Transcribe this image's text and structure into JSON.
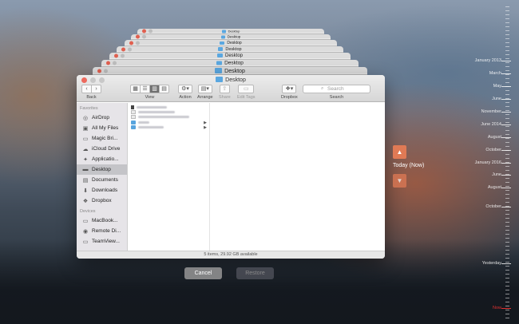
{
  "stack_windows": [
    {
      "title": "Desktop"
    },
    {
      "title": "Desktop"
    },
    {
      "title": "Desktop"
    },
    {
      "title": "Desktop"
    },
    {
      "title": "Desktop"
    },
    {
      "title": "Desktop"
    },
    {
      "title": "Desktop"
    },
    {
      "title": "Desktop"
    }
  ],
  "finder": {
    "title": "Desktop",
    "toolbar": {
      "back_label": "Back",
      "view_label": "View",
      "action_label": "Action",
      "arrange_label": "Arrange",
      "share_label": "Share",
      "edit_tags_label": "Edit Tags",
      "dropbox_label": "Dropbox",
      "search_label": "Search",
      "search_placeholder": "Search"
    },
    "sidebar": {
      "favorites_heading": "Favorites",
      "devices_heading": "Devices",
      "favorites": [
        {
          "label": "AirDrop",
          "icon": "airdrop-icon"
        },
        {
          "label": "All My Files",
          "icon": "all-files-icon"
        },
        {
          "label": "Magic Bri...",
          "icon": "folder-icon"
        },
        {
          "label": "iCloud Drive",
          "icon": "cloud-icon"
        },
        {
          "label": "Applicatio...",
          "icon": "applications-icon"
        },
        {
          "label": "Desktop",
          "icon": "desktop-icon",
          "selected": true
        },
        {
          "label": "Documents",
          "icon": "documents-icon"
        },
        {
          "label": "Downloads",
          "icon": "downloads-icon"
        },
        {
          "label": "Dropbox",
          "icon": "dropbox-icon"
        }
      ],
      "devices": [
        {
          "label": "MacBook...",
          "icon": "laptop-icon"
        },
        {
          "label": "Remote Di...",
          "icon": "disc-icon"
        },
        {
          "label": "TeamView...",
          "icon": "disk-icon"
        }
      ]
    },
    "status": "5 items, 29.92 GB available"
  },
  "buttons": {
    "cancel": "Cancel",
    "restore": "Restore"
  },
  "nav": {
    "current_label": "Today (Now)"
  },
  "timeline": [
    "January 2013",
    "March",
    "May",
    "June",
    "November",
    "June 2014",
    "August",
    "October",
    "January 2016",
    "June",
    "August",
    "October",
    "Yesterday",
    "Now"
  ]
}
